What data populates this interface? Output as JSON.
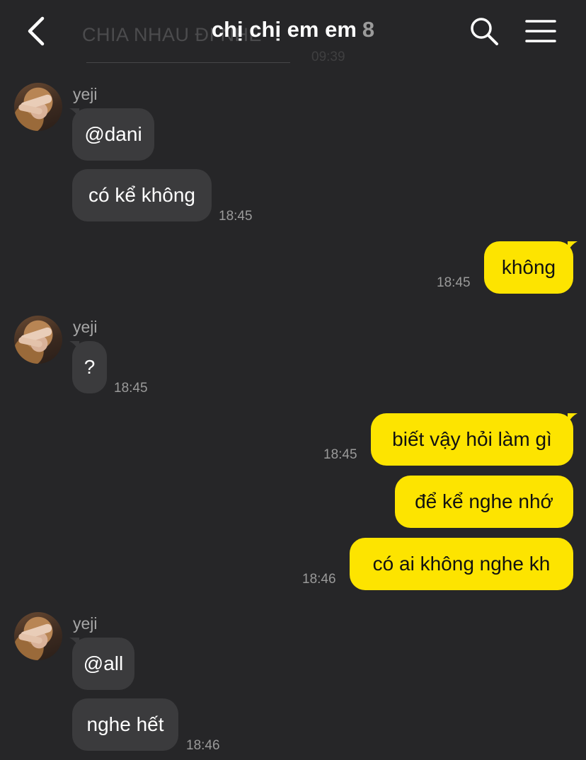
{
  "header": {
    "title": "chị chị em em",
    "member_count": "8",
    "icons": {
      "back": "back-chevron-icon",
      "search": "search-icon",
      "menu": "hamburger-menu-icon"
    }
  },
  "background_message": {
    "text": "CHIA NHAU ĐI NHÉ",
    "time": "09:39"
  },
  "colors": {
    "background": "#262628",
    "incoming_bubble": "#3b3b3d",
    "outgoing_bubble": "#fde400",
    "timestamp": "#9a9a9a"
  },
  "messages": {
    "g1": {
      "sender": "yeji",
      "m1": "@dani",
      "m2": "có kể không",
      "time": "18:45"
    },
    "o1": {
      "text": "không",
      "time": "18:45"
    },
    "g2": {
      "sender": "yeji",
      "m1": "?",
      "time": "18:45"
    },
    "o2": {
      "m1": "biết vậy hỏi làm gì",
      "m2": "để kể nghe nhớ",
      "m3": "có ai không nghe kh",
      "time1": "18:45",
      "time3": "18:46"
    },
    "g3": {
      "sender": "yeji",
      "m1": "@all",
      "m2": "nghe hết",
      "time": "18:46"
    }
  }
}
